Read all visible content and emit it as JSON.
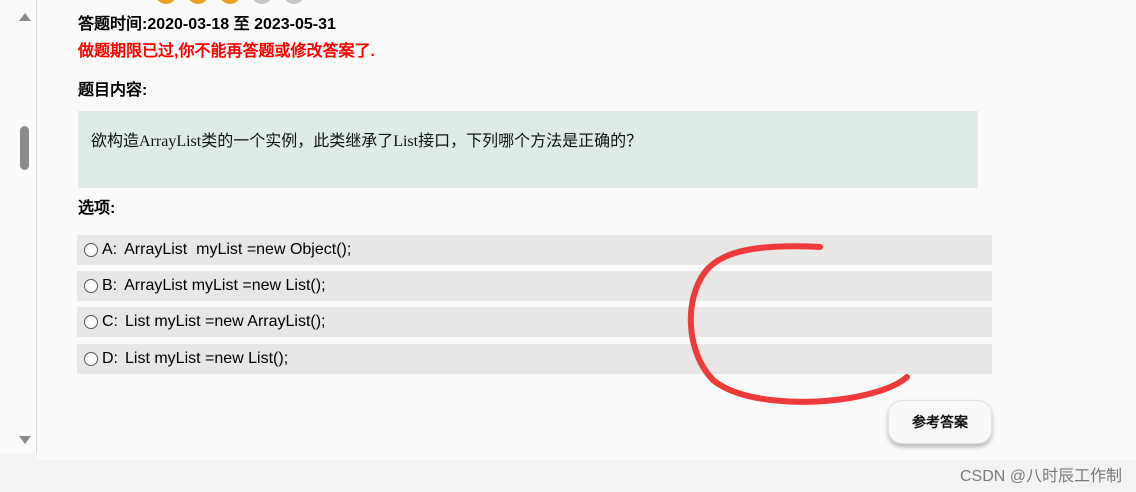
{
  "header": {
    "time_label": "答题时间:2020-03-18 至 2023-05-31",
    "warning": "做题期限已过,你不能再答题或修改答案了."
  },
  "question": {
    "heading": "题目内容:",
    "text": "欲构造ArrayList类的一个实例，此类继承了List接口，下列哪个方法是正确的？"
  },
  "options": {
    "heading": "选项:",
    "items": [
      {
        "letter": "A:",
        "text": "ArrayList  myList =new Object();"
      },
      {
        "letter": "B:",
        "text": "ArrayList myList =new List();"
      },
      {
        "letter": "C:",
        "text": "List myList =new ArrayList();"
      },
      {
        "letter": "D:",
        "text": "List myList =new List();"
      }
    ]
  },
  "actions": {
    "reference_answer_label": "参考答案"
  },
  "watermark": "CSDN @八时辰工作制",
  "colors": {
    "warning": "#ff0000",
    "question_bg": "#deebe9",
    "option_bg": "#e9e6e6",
    "annotation_stroke": "#f03a3a"
  },
  "icons": {
    "rating": "star-icon",
    "scroll_up": "chevron-up-icon",
    "scroll_down": "chevron-down-icon"
  }
}
